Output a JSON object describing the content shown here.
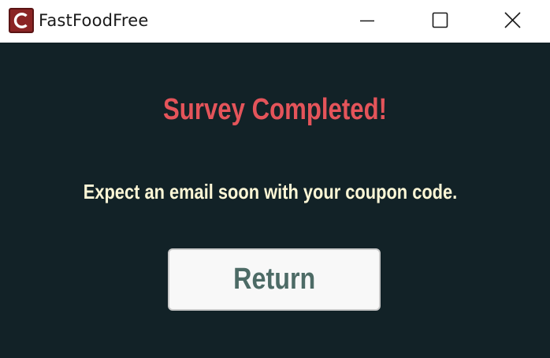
{
  "window": {
    "title": "FastFoodFree",
    "app_icon": "fastfoodfree-c-logo-icon",
    "controls": [
      "minimize-icon",
      "maximize-icon",
      "close-icon"
    ]
  },
  "content": {
    "heading": "Survey Completed!",
    "message": "Expect an email soon with your coupon code.",
    "return_label": "Return"
  },
  "colors": {
    "background": "#122227",
    "heading": "#e4545a",
    "message": "#fdf7d6",
    "button_bg": "#f8f8f8",
    "button_text": "#4d6b66",
    "icon_bg": "#8a2424"
  }
}
